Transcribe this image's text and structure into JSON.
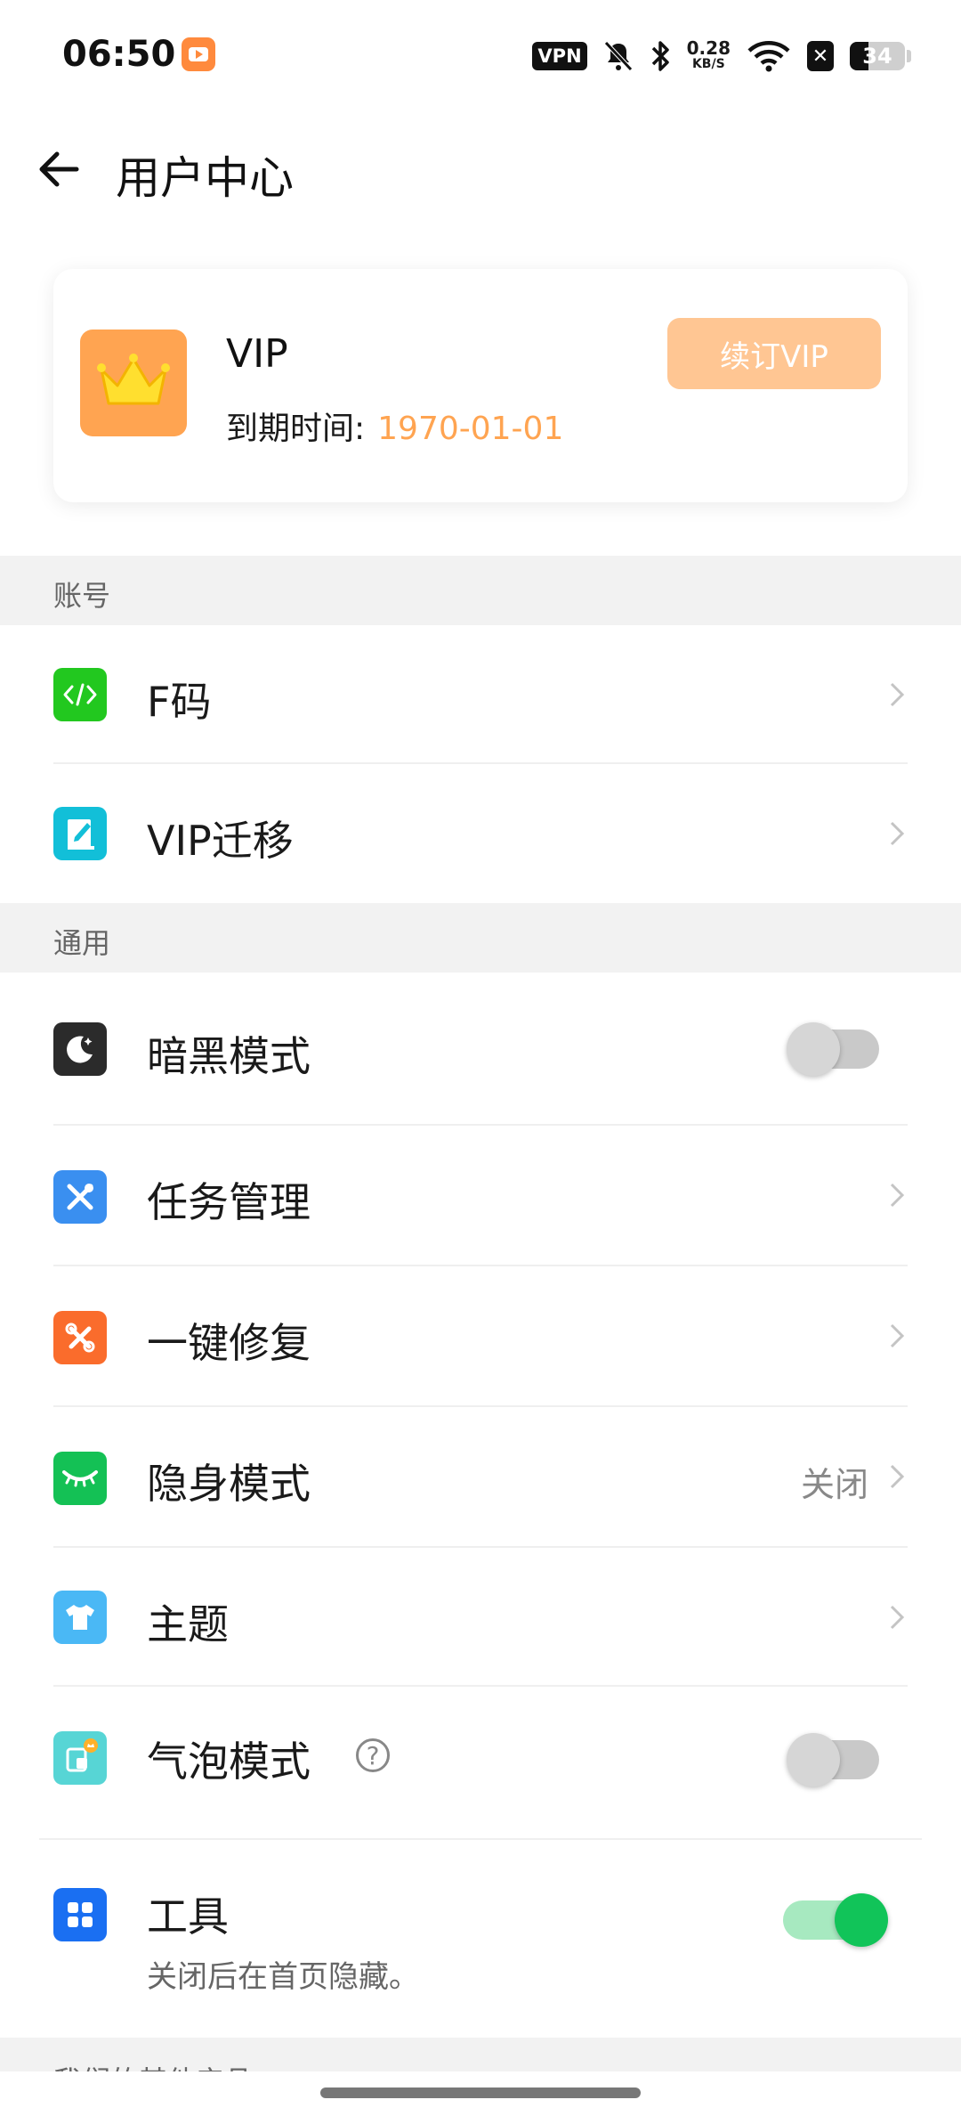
{
  "status_bar": {
    "time": "06:50",
    "vpn": "VPN",
    "speed_value": "0.28",
    "speed_unit": "KB/S",
    "battery": "34"
  },
  "header": {
    "title": "用户中心"
  },
  "vip_card": {
    "title": "VIP",
    "expire_label": "到期时间:",
    "expire_date": "1970-01-01",
    "renew_button": "续订VIP"
  },
  "sections": {
    "account": "账号",
    "general": "通用",
    "other_products": "我们的其他产品"
  },
  "account_items": [
    {
      "label": "F码",
      "icon": "code-icon"
    },
    {
      "label": "VIP迁移",
      "icon": "edit-book-icon"
    }
  ],
  "general_items": {
    "dark_mode": {
      "label": "暗黑模式",
      "icon": "moon-icon",
      "enabled": false
    },
    "task_manage": {
      "label": "任务管理",
      "icon": "tools-icon"
    },
    "one_click_repair": {
      "label": "一键修复",
      "icon": "repair-icon"
    },
    "stealth_mode": {
      "label": "隐身模式",
      "icon": "closed-eye-icon",
      "value": "关闭"
    },
    "theme": {
      "label": "主题",
      "icon": "shirt-icon"
    },
    "bubble_mode": {
      "label": "气泡模式",
      "icon": "bubble-icon",
      "help": "?",
      "enabled": false
    },
    "tools": {
      "label": "工具",
      "icon": "grid-icon",
      "sublabel": "关闭后在首页隐藏。",
      "enabled": true
    }
  },
  "colors": {
    "accent_orange": "#ffa451",
    "renew_button_bg": "#ffc693",
    "toggle_on": "#11c459",
    "section_bg": "#f2f2f2"
  }
}
